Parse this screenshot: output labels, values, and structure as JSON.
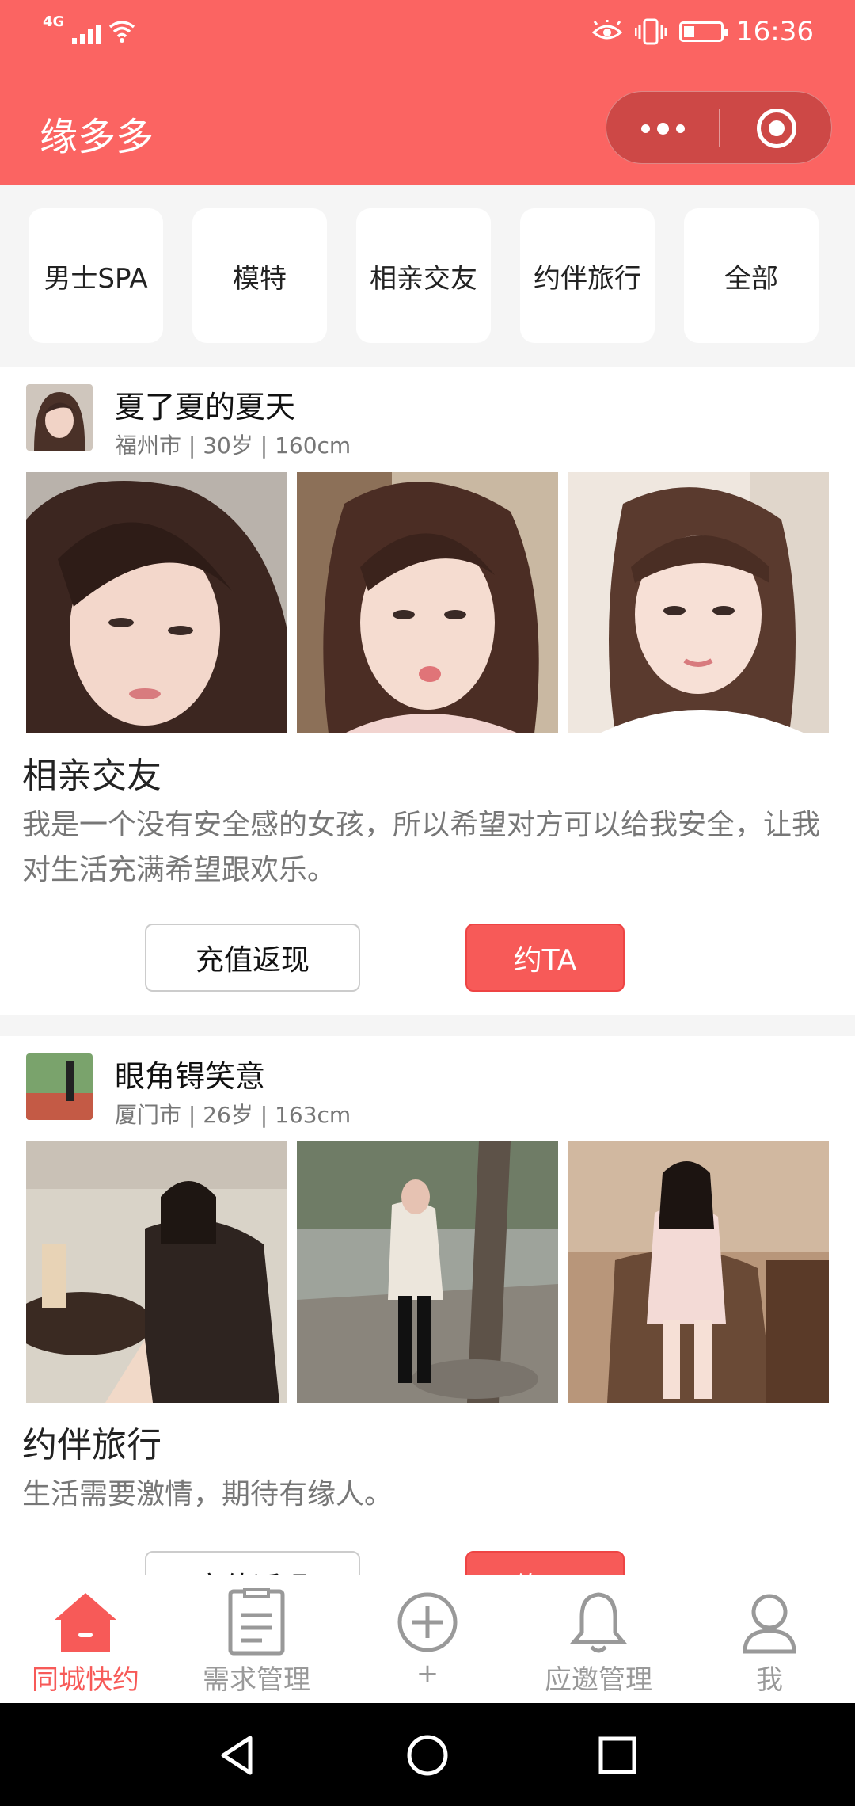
{
  "status_bar": {
    "network": "4G",
    "time": "16:36",
    "battery_level": 0.3
  },
  "header": {
    "title": "缘多多"
  },
  "categories": [
    {
      "label": "男士SPA"
    },
    {
      "label": "模特"
    },
    {
      "label": "相亲交友"
    },
    {
      "label": "约伴旅行"
    },
    {
      "label": "全部"
    }
  ],
  "posts": [
    {
      "name": "夏了夏的夏天",
      "meta": "福州市 | 30岁 | 160cm",
      "title": "相亲交友",
      "desc": "我是一个没有安全感的女孩，所以希望对方可以给我安全，让我对生活充满希望跟欢乐。",
      "recharge_label": "充值返现",
      "invite_label": "约TA"
    },
    {
      "name": "眼角锝笑意",
      "meta": "厦门市 | 26岁 | 163cm",
      "title": "约伴旅行",
      "desc": "生活需要激情，期待有缘人。",
      "recharge_label": "充值返现",
      "invite_label": "约TA"
    }
  ],
  "tabbar": [
    {
      "label": "同城快约",
      "icon": "home-icon",
      "active": true
    },
    {
      "label": "需求管理",
      "icon": "clipboard-icon",
      "active": false
    },
    {
      "label": "+",
      "icon": "add-circle-icon",
      "active": false
    },
    {
      "label": "应邀管理",
      "icon": "bell-icon",
      "active": false
    },
    {
      "label": "我",
      "icon": "user-icon",
      "active": false
    }
  ],
  "colors": {
    "accent": "#fb6462",
    "button": "#f75a58",
    "tab_inactive": "#999999"
  }
}
